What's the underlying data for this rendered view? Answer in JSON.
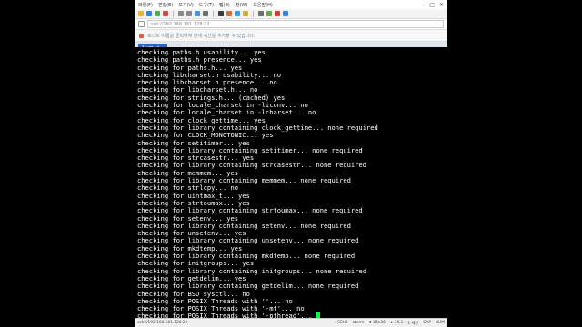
{
  "menu": [
    "파일(F)",
    "편집(E)",
    "보기(V)",
    "도구(T)",
    "탭(B)",
    "창(W)",
    "도움말(H)"
  ],
  "window_controls": [
    "–",
    "□",
    "✕"
  ],
  "toolbar_icons": [
    {
      "name": "new-session-icon",
      "color": "#e8b33c"
    },
    {
      "name": "open-icon",
      "color": "#3c7fd9"
    },
    {
      "name": "connect-icon",
      "color": "#5aa55a"
    },
    {
      "name": "disconnect-icon",
      "color": "#c94c4c"
    },
    {
      "name": "copy-icon",
      "color": "#8a8a8a"
    },
    {
      "name": "paste-icon",
      "color": "#8a8a8a"
    },
    {
      "name": "find-icon",
      "color": "#4d8fd1"
    },
    {
      "name": "print-icon",
      "color": "#6d6d6d"
    },
    {
      "name": "font-icon",
      "color": "#3a3a3a"
    },
    {
      "name": "color-icon",
      "color": "#d1733c"
    },
    {
      "name": "globe-icon",
      "color": "#3c9bd9"
    },
    {
      "name": "lock-icon",
      "color": "#d1b03c"
    },
    {
      "name": "keyboard-icon",
      "color": "#6d6d6d"
    },
    {
      "name": "script-icon",
      "color": "#6da34d"
    },
    {
      "name": "transfer-icon",
      "color": "#d13c3c"
    },
    {
      "name": "help-icon",
      "color": "#3c7fd9"
    }
  ],
  "address_bar": {
    "value": "ssh://192.168.181.128:22"
  },
  "info_bar": {
    "text": "호스트 이름을 클릭하여 현재 세션을 추가할 수 있습니다."
  },
  "tab": {
    "label": "1 vm",
    "close": "×"
  },
  "terminal": {
    "lines": [
      "checking paths.h usability... yes",
      "checking paths.h presence... yes",
      "checking for paths.h... yes",
      "checking libcharset.h usability... no",
      "checking libcharset.h presence... no",
      "checking for libcharset.h... no",
      "checking for strings.h... (cached) yes",
      "checking for locale_charset in -liconv... no",
      "checking for locale_charset in -lcharset... no",
      "checking for clock_gettime... yes",
      "checking for library containing clock_gettime... none required",
      "checking for CLOCK_MONOTONIC... yes",
      "checking for setitimer... yes",
      "checking for library containing setitimer... none required",
      "checking for strcasestr... yes",
      "checking for library containing strcasestr... none required",
      "checking for memmem... yes",
      "checking for library containing memmem... none required",
      "checking for strlcpy... no",
      "checking for uintmax_t... yes",
      "checking for strtoumax... yes",
      "checking for library containing strtoumax... none required",
      "checking for setenv... yes",
      "checking for library containing setenv... none required",
      "checking for unsetenv... yes",
      "checking for library containing unsetenv... none required",
      "checking for mkdtemp... yes",
      "checking for library containing mkdtemp... none required",
      "checking for initgroups... yes",
      "checking for library containing initgroups... none required",
      "checking for getdelim... yes",
      "checking for library containing getdelim... none required",
      "checking for BSD sysctl... no",
      "checking for POSIX Threads with ''... no",
      "checking for POSIX Threads with '-mt'... no"
    ],
    "last_line": "checking for POSIX Threads with '-pthread'... "
  },
  "status_bar": {
    "left": "ssh://192.168.181.128:22",
    "items": [
      "SSH2",
      "xterm",
      "↕ 84x36",
      "↓ 36,1",
      "1 세션",
      "CAP",
      "NUM"
    ]
  }
}
